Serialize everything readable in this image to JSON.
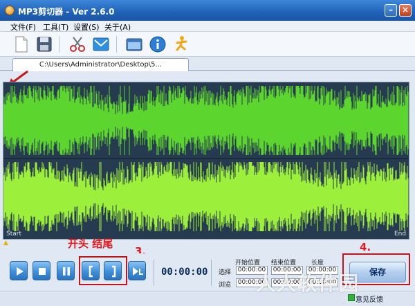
{
  "window": {
    "title": "MP3剪切器 - Ver 2.6.0",
    "minimize_glyph": "–",
    "close_glyph": "×"
  },
  "menu": {
    "items": [
      {
        "label": "文件(F)"
      },
      {
        "label": "工具(T)"
      },
      {
        "label": "设置(S)"
      },
      {
        "label": "关于(A)"
      }
    ]
  },
  "toolbar": {
    "buttons": [
      {
        "icon": "new-file-icon"
      },
      {
        "icon": "save-disk-icon"
      },
      {
        "icon": "scissors-icon"
      },
      {
        "icon": "email-icon"
      },
      {
        "icon": "window-icon"
      },
      {
        "icon": "info-icon"
      },
      {
        "icon": "running-man-icon"
      }
    ]
  },
  "tab": {
    "label": "C:\\Users\\Administrator\\Desktop\\5..."
  },
  "wave": {
    "start_label": "Start",
    "end_label": "End",
    "color_dark": "#5cd62e",
    "color_light": "#9cf03c",
    "background": "#273b50"
  },
  "annotations": {
    "start_end": "开头  结尾",
    "step3": "3.",
    "step4": "4."
  },
  "player": {
    "time": "00:00:00",
    "buttons": [
      {
        "icon": "play-icon"
      },
      {
        "icon": "stop-icon"
      },
      {
        "icon": "pause-icon"
      },
      {
        "icon": "set-start-bracket-icon"
      },
      {
        "icon": "set-end-bracket-icon"
      },
      {
        "icon": "play-selection-icon"
      }
    ]
  },
  "positions": {
    "header_start": "开始位置",
    "header_end": "结束位置",
    "header_length": "长度",
    "row_select": "选择",
    "row_browse": "浏览",
    "select_start": "00:00:00",
    "select_end": "00:00:00",
    "select_length": "00:00:00",
    "browse_start": "00:00:00",
    "browse_end": "00:00:00",
    "browse_length": "00:00:00"
  },
  "save_button": {
    "label": "保存"
  },
  "status": {
    "feedback": "意见反馈"
  },
  "watermark": {
    "text": "人人软件园"
  },
  "colors": {
    "accent": "#2a72c0",
    "annotation_red": "#e4161b"
  }
}
